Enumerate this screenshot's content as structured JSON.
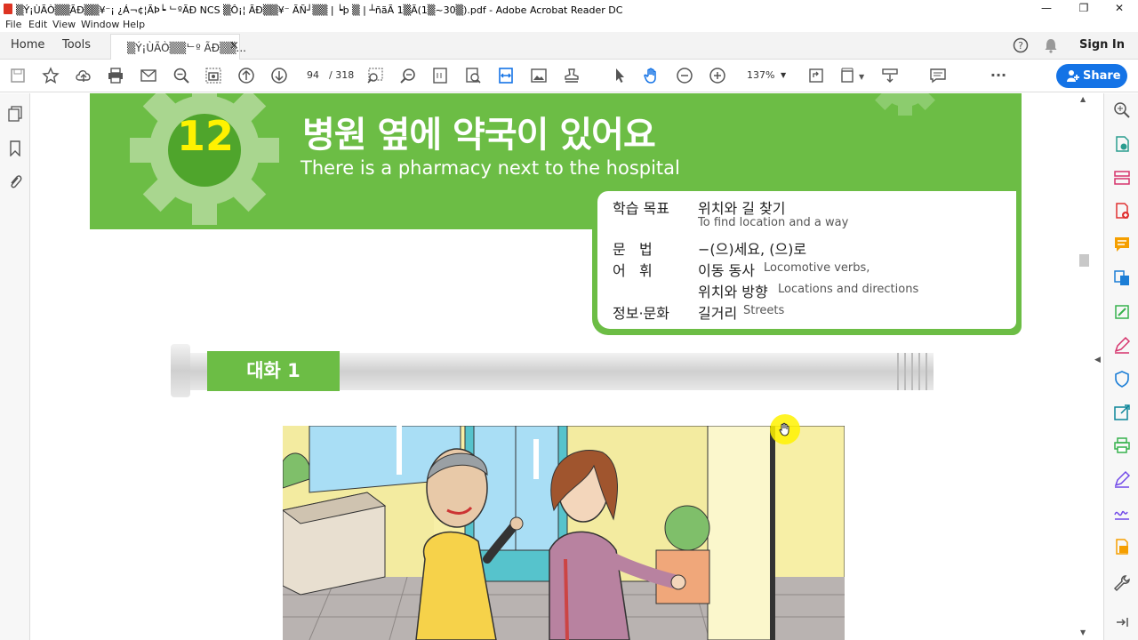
{
  "window": {
    "title": "▒Ý¡ÙÃÒ▒▒ÃÐ▒▒¥⁻¡ ¿Á¬¢¦ÃÞ┕ ᄂºÃÐ NCS ▒Ô¡¦ ÃÐ▒▒¥⁻ ÃÑ┘▒▒ | ┕þ ▒ | ┴ñãÃ 1▒Ã(1▒~30▒).pdf - Adobe Acrobat Reader DC",
    "minimize": "—",
    "maximize": "❐",
    "close": "✕"
  },
  "menu": [
    "File",
    "Edit",
    "View",
    "Window",
    "Help"
  ],
  "tabs": {
    "home": "Home",
    "tools": "Tools",
    "doc_tab": "▒Ý¡ÙÃÒ▒▒ᄂº ÃÐ▒▒...",
    "doc_tab_close": "×",
    "sign_in": "Sign In"
  },
  "toolbar": {
    "page_current": "94",
    "page_sep": "/",
    "page_total": "318",
    "zoom": "137%",
    "share": "Share"
  },
  "lesson": {
    "number": "12",
    "title_kr": "병원 옆에 약국이 있어요",
    "title_en": "There is a pharmacy next to the hospital",
    "goals": [
      {
        "label": "학습 목표",
        "kr": "위치와 길 찾기",
        "en": "To find location and a way"
      },
      {
        "label": "문   법",
        "kr": "−(으)세요, (으)로",
        "en": ""
      },
      {
        "label": "어   휘",
        "kr": "이동 동사",
        "en": "Locomotive verbs,"
      },
      {
        "label": "",
        "kr": "위치와 방향",
        "en": "Locations and directions"
      },
      {
        "label": "정보·문화",
        "kr": "길거리",
        "en": "Streets"
      }
    ],
    "dialogue_label": "대화 1"
  },
  "colors": {
    "green": "#6cbd45",
    "dark_green": "#4fa52c",
    "gear": "#a9d68f",
    "number_yellow": "#fff200",
    "share_blue": "#1473e6"
  }
}
